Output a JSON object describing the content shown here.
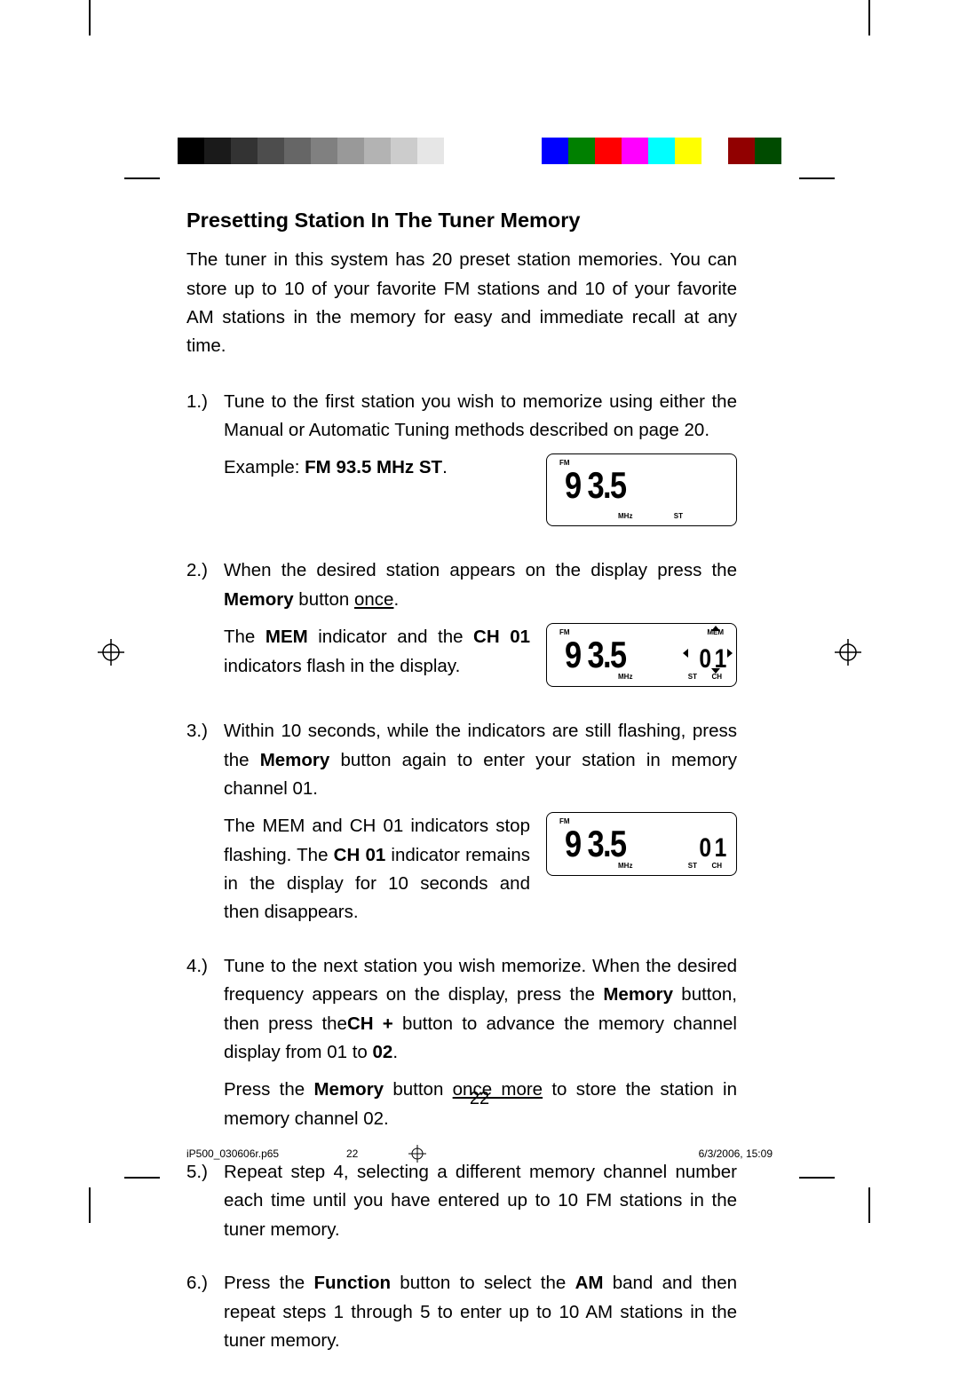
{
  "heading": "Presetting Station In The Tuner Memory",
  "intro": "The tuner in this system has 20 preset station memories. You can store up to 10 of your favorite FM stations and 10 of your favorite AM stations in the memory for easy and immediate recall at any time.",
  "steps": {
    "s1_num": "1.)",
    "s1_a": "Tune to the first station you wish to memorize using either the Manual or Automatic Tuning methods described on page 20.",
    "s1_b_pre": "Example: ",
    "s1_b_bold": "FM 93.5 MHz ST",
    "s1_b_post": ".",
    "s2_num": "2.)",
    "s2_a_pre": "When the desired station appears on the display press the ",
    "s2_a_bold": "Memory",
    "s2_a_mid": " button ",
    "s2_a_under": "once",
    "s2_a_post": ".",
    "s2_b_pre": "The ",
    "s2_b_bold1": "MEM",
    "s2_b_mid1": " indicator and the ",
    "s2_b_bold2": "CH 01",
    "s2_b_post": " indicators flash in the display.",
    "s3_num": "3.)",
    "s3_a_pre": "Within 10 seconds, while the indicators are still flashing, press the ",
    "s3_a_bold": "Memory",
    "s3_a_post": " button again to enter your station in memory channel 01.",
    "s3_b_pre": "The MEM and CH 01 indicators stop flashing. The ",
    "s3_b_bold": "CH 01",
    "s3_b_post": " indicator remains in the display for 10 seconds and then disappears.",
    "s4_num": "4.)",
    "s4_a_pre": "Tune to the next station you wish memorize. When the desired frequency appears on the display, press the ",
    "s4_a_bold1": "Memory",
    "s4_a_mid1": " button, then press the",
    "s4_a_bold2": "CH +",
    "s4_a_mid2": " button to advance the memory channel display from 01 to ",
    "s4_a_bold3": "02",
    "s4_a_post": ".",
    "s4_b_pre": "Press the ",
    "s4_b_bold": "Memory",
    "s4_b_mid": " button ",
    "s4_b_under": "once more",
    "s4_b_post": " to store the station in memory channel 02.",
    "s5_num": "5.)",
    "s5": "Repeat step 4, selecting a different memory channel number each time until you have entered up to 10 FM stations in the tuner memory.",
    "s6_num": "6.)",
    "s6_pre": "Press the ",
    "s6_bold1": "Function",
    "s6_mid1": " button to select the ",
    "s6_bold2": "AM",
    "s6_post": " band and then repeat steps 1 through 5 to enter up to 10 AM stations in the tuner memory."
  },
  "lcd": {
    "fm": "FM",
    "mem": "MEM",
    "freq": "9 3.5",
    "mhz": "MHz",
    "st": "ST",
    "ch": "CH",
    "chnum": "0 1"
  },
  "colorbars": {
    "gray": [
      "#000000",
      "#1a1a1a",
      "#333333",
      "#4d4d4d",
      "#666666",
      "#808080",
      "#999999",
      "#b3b3b3",
      "#cccccc",
      "#e6e6e6",
      "#ffffff"
    ],
    "color": [
      "#0000ff",
      "#008000",
      "#ff0000",
      "#ff00ff",
      "#00ffff",
      "#ffff00",
      "#ffffff",
      "#910000",
      "#004b00"
    ]
  },
  "pagenum": "22",
  "footer": {
    "filename": "iP500_030606r.p65",
    "page": "22",
    "timestamp": "6/3/2006, 15:09"
  }
}
